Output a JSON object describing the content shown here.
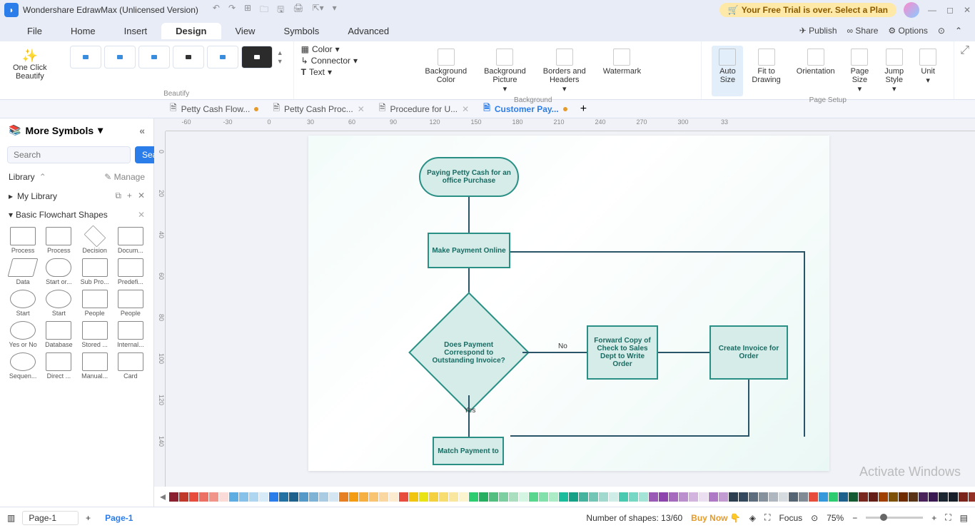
{
  "titlebar": {
    "app": "Wondershare EdrawMax (Unlicensed Version)",
    "trial_msg": "Your Free Trial is over. Select a Plan"
  },
  "menu": {
    "items": [
      "File",
      "Home",
      "Insert",
      "Design",
      "View",
      "Symbols",
      "Advanced"
    ],
    "active": "Design",
    "right": {
      "publish": "Publish",
      "share": "Share",
      "options": "Options"
    }
  },
  "ribbon": {
    "one_click": "One Click\nBeautify",
    "beautify_label": "Beautify",
    "color": "Color",
    "connector": "Connector",
    "text": "Text",
    "bg_color": "Background\nColor",
    "bg_pic": "Background\nPicture",
    "borders": "Borders and\nHeaders",
    "watermark": "Watermark",
    "background_label": "Background",
    "auto": "Auto\nSize",
    "fit": "Fit to\nDrawing",
    "orient": "Orientation",
    "page_size": "Page\nSize",
    "jump": "Jump\nStyle",
    "unit": "Unit",
    "page_setup_label": "Page Setup"
  },
  "doctabs": {
    "items": [
      {
        "label": "Petty Cash Flow...",
        "dirty": true
      },
      {
        "label": "Petty Cash Proc...",
        "dirty": false
      },
      {
        "label": "Procedure for U...",
        "dirty": false
      },
      {
        "label": "Customer Pay...",
        "dirty": true,
        "active": true
      }
    ]
  },
  "leftpanel": {
    "more_symbols": "More Symbols",
    "search_placeholder": "Search",
    "search_btn": "Search",
    "library": "Library",
    "manage": "Manage",
    "mylib": "My Library",
    "section": "Basic Flowchart Shapes",
    "shapes": [
      "Process",
      "Process",
      "Decision",
      "Docum...",
      "Data",
      "Start or...",
      "Sub Pro...",
      "Predefi...",
      "Start",
      "Start",
      "People",
      "People",
      "Yes or No",
      "Database",
      "Stored ...",
      "Internal...",
      "Sequen...",
      "Direct ...",
      "Manual...",
      "Card"
    ]
  },
  "canvas": {
    "ruler_h": [
      "-60",
      "-30",
      "0",
      "30",
      "60",
      "90",
      "120",
      "150",
      "180",
      "210",
      "240",
      "270",
      "300",
      "33"
    ],
    "ruler_v": [
      "0",
      "20",
      "40",
      "60",
      "80",
      "100",
      "120",
      "140"
    ],
    "nodes": {
      "start": "Paying Petty Cash for an office Purchase",
      "make": "Make Payment Online",
      "dec": "Does Payment Correspond to Outstanding Invoice?",
      "fwd": "Forward Copy of Check to Sales Dept to Write Order",
      "create": "Create Invoice for Order",
      "match": "Match Payment to"
    },
    "labels": {
      "no": "No",
      "yes": "Yes"
    },
    "activate": "Activate Windows"
  },
  "status": {
    "page_sel": "Page-1",
    "page_tab": "Page-1",
    "shapes_count": "Number of shapes: 13/60",
    "buy": "Buy Now",
    "focus": "Focus",
    "zoom": "75%"
  },
  "colors": [
    "#8b2030",
    "#c0392b",
    "#e74c3c",
    "#ec7063",
    "#f1948a",
    "#fadbd8",
    "#5dade2",
    "#85c1e9",
    "#aed6f1",
    "#d6eaf8",
    "#2b7de9",
    "#2471a3",
    "#1f618d",
    "#5499c7",
    "#7fb3d5",
    "#a9cce3",
    "#d4e6f1",
    "#e67e22",
    "#f39c12",
    "#f5b041",
    "#f8c471",
    "#fad7a0",
    "#fdebd0",
    "#e74c3c",
    "#f1c40f",
    "#e9e316",
    "#f4d03f",
    "#f7dc6f",
    "#f9e79f",
    "#fcf3cf",
    "#2ecc71",
    "#27ae60",
    "#52be80",
    "#7dcea0",
    "#a9dfbf",
    "#d5f5e3",
    "#58d68d",
    "#82e0aa",
    "#abebc6",
    "#1abc9c",
    "#16a085",
    "#45b39d",
    "#73c6b6",
    "#a2d9ce",
    "#d0ece7",
    "#48c9b0",
    "#76d7c4",
    "#a3e4d7",
    "#9b59b6",
    "#8e44ad",
    "#a569bd",
    "#bb8fce",
    "#d2b4de",
    "#ebdef0",
    "#af7ac5",
    "#c39bd3",
    "#2c3e50",
    "#34495e",
    "#5d6d7e",
    "#85929e",
    "#aeb6bf",
    "#d6dbdf",
    "#566573",
    "#808b96",
    "#e74c3c",
    "#3498db",
    "#2ecc71",
    "#1f618d",
    "#145a32",
    "#78281f",
    "#641e16",
    "#a04000",
    "#7e5109",
    "#6e2c00",
    "#5a3317",
    "#4a235a",
    "#3a1852",
    "#1b2631",
    "#17202a",
    "#7b241c",
    "#943126",
    "#b03a2e",
    "#800000",
    "#322f2b",
    "#966d42",
    "#6b4423",
    "#211a0e",
    "#473419",
    "#5c4033",
    "#3b2c1c",
    "#8b4513",
    "#a0522d",
    "#cd853f",
    "#d2691e",
    "#b8860b",
    "#eee",
    "#ddd",
    "#ccc",
    "#bbb",
    "#aaa",
    "#999",
    "#888",
    "#777",
    "#666",
    "#555",
    "#444",
    "#333",
    "#222",
    "#111",
    "#000"
  ]
}
